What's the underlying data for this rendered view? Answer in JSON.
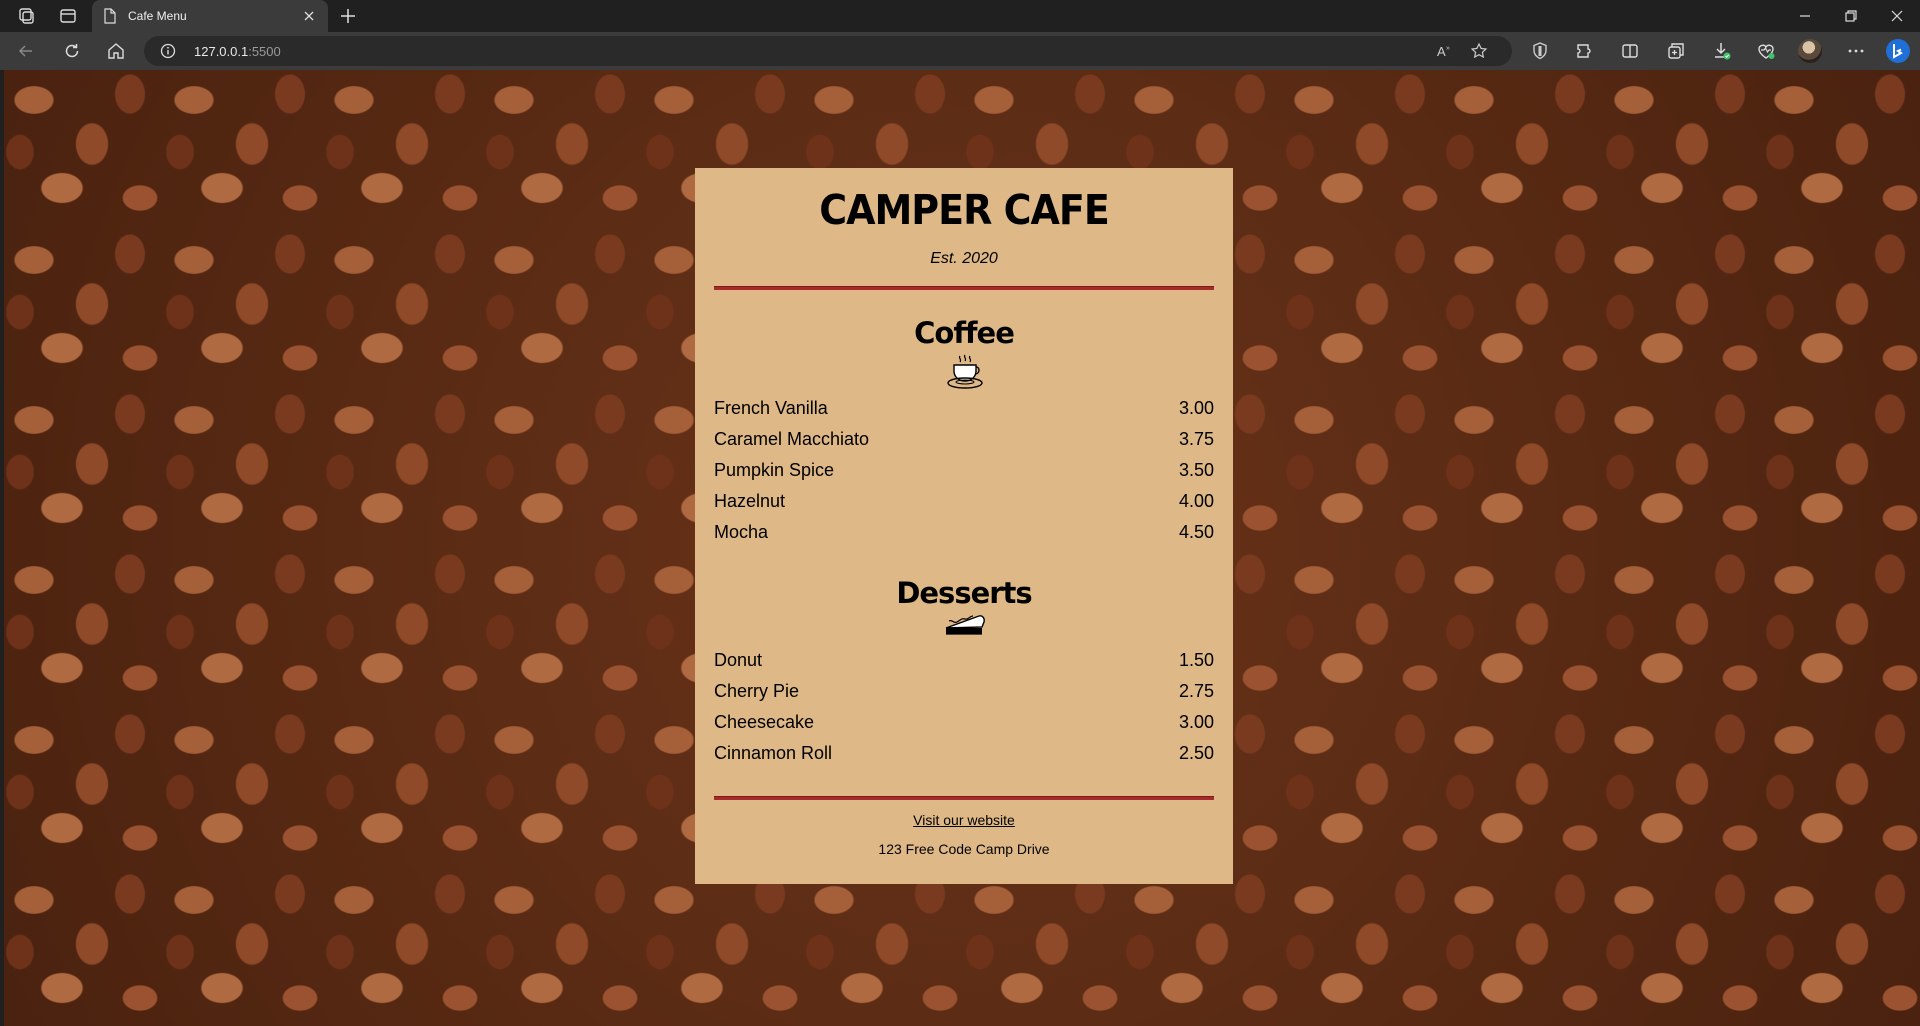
{
  "browser": {
    "tab_title": "Cafe Menu",
    "url_host": "127.0.0.1",
    "url_port": ":5500"
  },
  "menu": {
    "title": "CAMPER CAFE",
    "established": "Est. 2020",
    "sections": [
      {
        "heading": "Coffee",
        "icon": "coffee-cup-icon",
        "items": [
          {
            "name": "French Vanilla",
            "price": "3.00"
          },
          {
            "name": "Caramel Macchiato",
            "price": "3.75"
          },
          {
            "name": "Pumpkin Spice",
            "price": "3.50"
          },
          {
            "name": "Hazelnut",
            "price": "4.00"
          },
          {
            "name": "Mocha",
            "price": "4.50"
          }
        ]
      },
      {
        "heading": "Desserts",
        "icon": "pie-slice-icon",
        "items": [
          {
            "name": "Donut",
            "price": "1.50"
          },
          {
            "name": "Cherry Pie",
            "price": "2.75"
          },
          {
            "name": "Cheesecake",
            "price": "3.00"
          },
          {
            "name": "Cinnamon Roll",
            "price": "2.50"
          }
        ]
      }
    ],
    "footer": {
      "link_text": "Visit our website",
      "address": "123 Free Code Camp Drive"
    }
  },
  "colors": {
    "menu_background": "#deb887",
    "rule": "#a52a2a"
  }
}
